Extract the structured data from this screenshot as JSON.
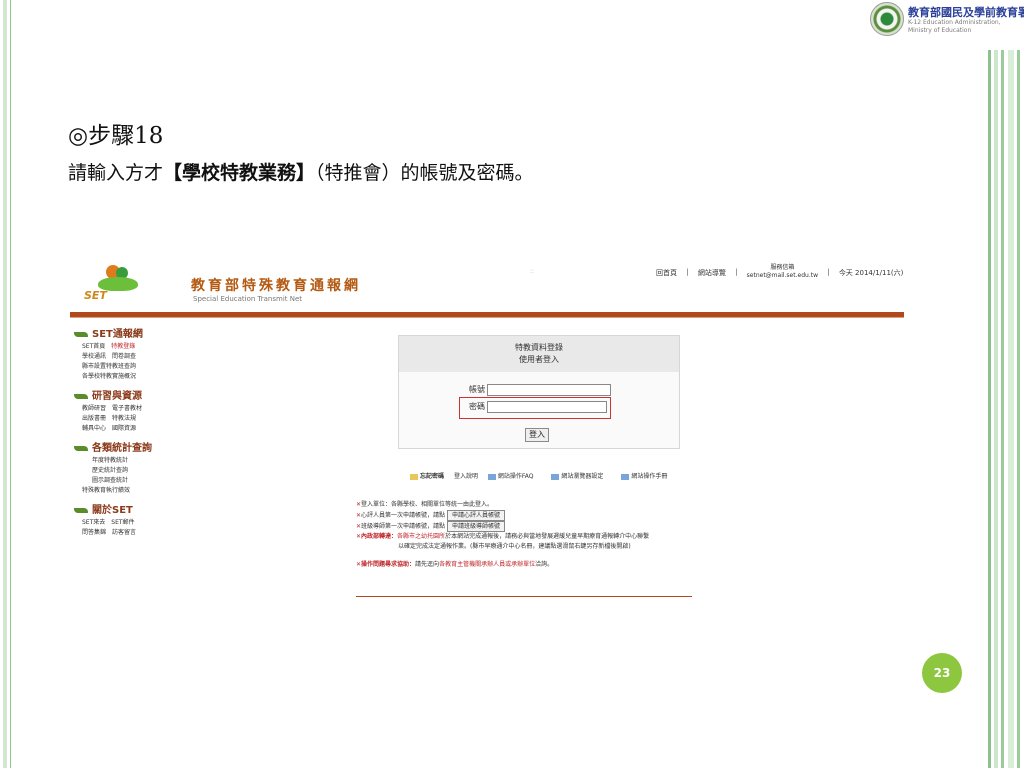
{
  "branding": {
    "moe_title": "教育部國民及學前教育署",
    "moe_sub_line1": "K-12 Education Administration,",
    "moe_sub_line2": "Ministry of Education"
  },
  "slide": {
    "step_title": "◎步驟18",
    "desc_prefix": "請輸入方才",
    "desc_bold": "【學校特教業務】",
    "desc_suffix": "（特推會）的帳號及密碼。",
    "page_number": "23"
  },
  "site": {
    "logo_text": "SET",
    "title": "教育部特殊教育通報網",
    "subtitle": "Special Education Transmit Net",
    "dots": "::",
    "nav": {
      "home": "回首頁",
      "sep": "|",
      "guide": "網站導覽",
      "service_label": "服務信箱",
      "service_email": "setnet@mail.set.edu.tw",
      "today": "今天 2014/1/11(六)"
    }
  },
  "menu": {
    "set_title": "SET通報網",
    "set_items": [
      [
        "SET首頁",
        "特教登錄"
      ],
      [
        "學校通訊",
        "問卷調查"
      ],
      [
        "縣市設置特教班查詢"
      ],
      [
        "各學校特教實施概況"
      ]
    ],
    "research_title": "研習與資源",
    "research_items": [
      [
        "教師研習",
        "電子書教材"
      ],
      [
        "出版書冊",
        "特教法規"
      ],
      [
        "輔具中心",
        "國際資源"
      ]
    ],
    "stats_title": "各類統計查詢",
    "stats_items": [
      [
        "年度特教統計"
      ],
      [
        "歷史統計查詢"
      ],
      [
        "圖示調查統計"
      ],
      [
        "特殊教育執行績效"
      ]
    ],
    "about_title": "關於SET",
    "about_items": [
      [
        "SET來去",
        "SET郵件"
      ],
      [
        "問答集錦",
        "訪客留言"
      ]
    ]
  },
  "login": {
    "title_line1": "特教資料登錄",
    "title_line2": "使用者登入",
    "account_label": "帳號",
    "password_label": "密碼",
    "account_value": "",
    "password_value": "",
    "submit_label": "登入"
  },
  "links": {
    "forgot": "忘記密碼",
    "login_help": "登入說明",
    "faq": "網站操作FAQ",
    "browser": "網站瀏覽器設定",
    "manual": "網站操作手冊"
  },
  "notes": {
    "n1_mark": "✕",
    "n1_text": "登入單位：各縣學校、相關單位等統一由此登入。",
    "n2_mark": "✕",
    "n2_text": "心評人員第一次申請帳號，請點",
    "n2_button": "申請心評人員帳號",
    "n3_mark": "✕",
    "n3_text": "班級導師第一次申請帳號，請點",
    "n3_button": "申請班級導師帳號",
    "n4_mark": "✕",
    "n4_bold": "內政部轉達：",
    "n4_red": "各縣市之幼托園所",
    "n4_text": "於本網站完成通報後，請務必與當地發展遲緩兒童早期療育通報轉介中心聯繫",
    "n4_text2": "以確定完成法定通報作業。(縣市早療通介中心名冊，建議點選滑鼠右鍵另存新檔後開啟)",
    "n5_mark": "✕",
    "n5_bold": "操作問題尋求協助：",
    "n5_text1": "請先逕向",
    "n5_red": "各教育主管機關承辦人員或承辦單位",
    "n5_text2": "洽詢。"
  },
  "colors": {
    "accent_green": "#8dc63f",
    "header_rule": "#b04a1c",
    "highlight_red": "#cc3333"
  }
}
